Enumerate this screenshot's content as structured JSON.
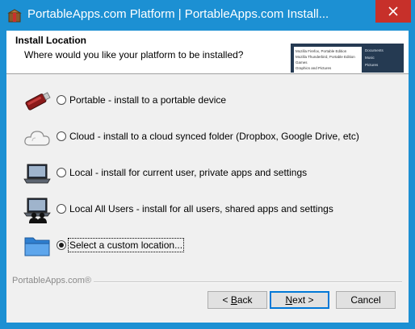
{
  "window": {
    "title": "PortableApps.com Platform | PortableApps.com Install..."
  },
  "header": {
    "title": "Install Location",
    "subtitle": "Where would you like your platform to be installed?",
    "thumbnail": {
      "left_items": [
        "Mozilla Firefox, Portable Edition",
        "Mozilla Thunderbird, Portable Edition",
        "Games",
        "Graphics and Pictures"
      ],
      "right_items": [
        "Documents",
        "Music",
        "Pictures"
      ]
    }
  },
  "options": [
    {
      "label": "Portable - install to a portable device",
      "checked": false,
      "icon": "usb-drive-icon"
    },
    {
      "label": "Cloud - install to a cloud synced folder (Dropbox, Google Drive, etc)",
      "checked": false,
      "icon": "cloud-icon"
    },
    {
      "label": "Local - install for current user, private apps and settings",
      "checked": false,
      "icon": "laptop-icon"
    },
    {
      "label": "Local All Users - install for all users, shared apps and settings",
      "checked": false,
      "icon": "laptop-users-icon"
    },
    {
      "label": "Select a custom location...",
      "checked": true,
      "icon": "folder-icon"
    }
  ],
  "footer": {
    "brand": "PortableApps.com®",
    "back_prefix": "< ",
    "back_accel": "B",
    "back_rest": "ack",
    "next_accel": "N",
    "next_rest": "ext >",
    "cancel": "Cancel"
  },
  "colors": {
    "titlebar": "#1c90d3",
    "close": "#c7302a",
    "accent": "#0078d7"
  }
}
